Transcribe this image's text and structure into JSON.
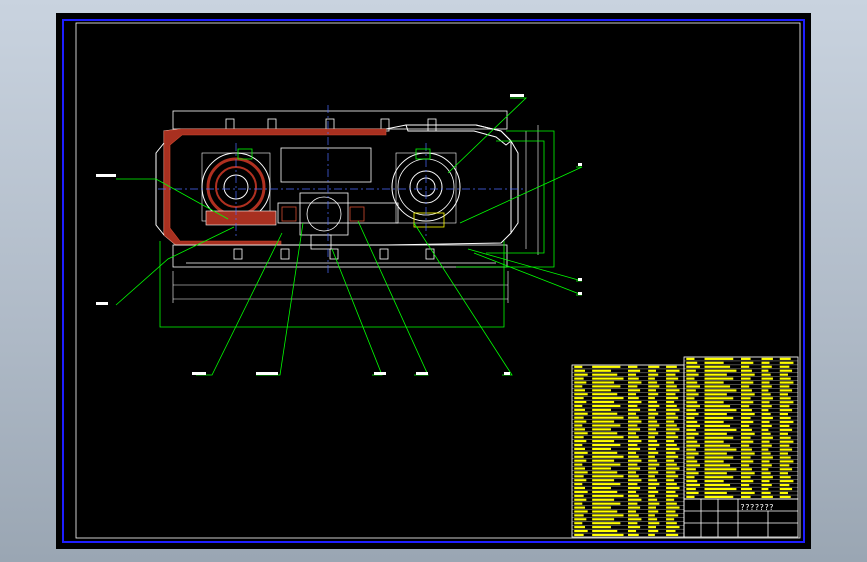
{
  "colors": {
    "background": "#000000",
    "frame": "#1e1eff",
    "callout": "#00ff00",
    "section": "#b03020",
    "table": "#ffff00",
    "dim": "#ffffff",
    "center": "#4d6bff"
  },
  "title_block": {
    "drawing_number": "???????"
  },
  "drawing": {
    "callout_count": 11,
    "description": ""
  }
}
